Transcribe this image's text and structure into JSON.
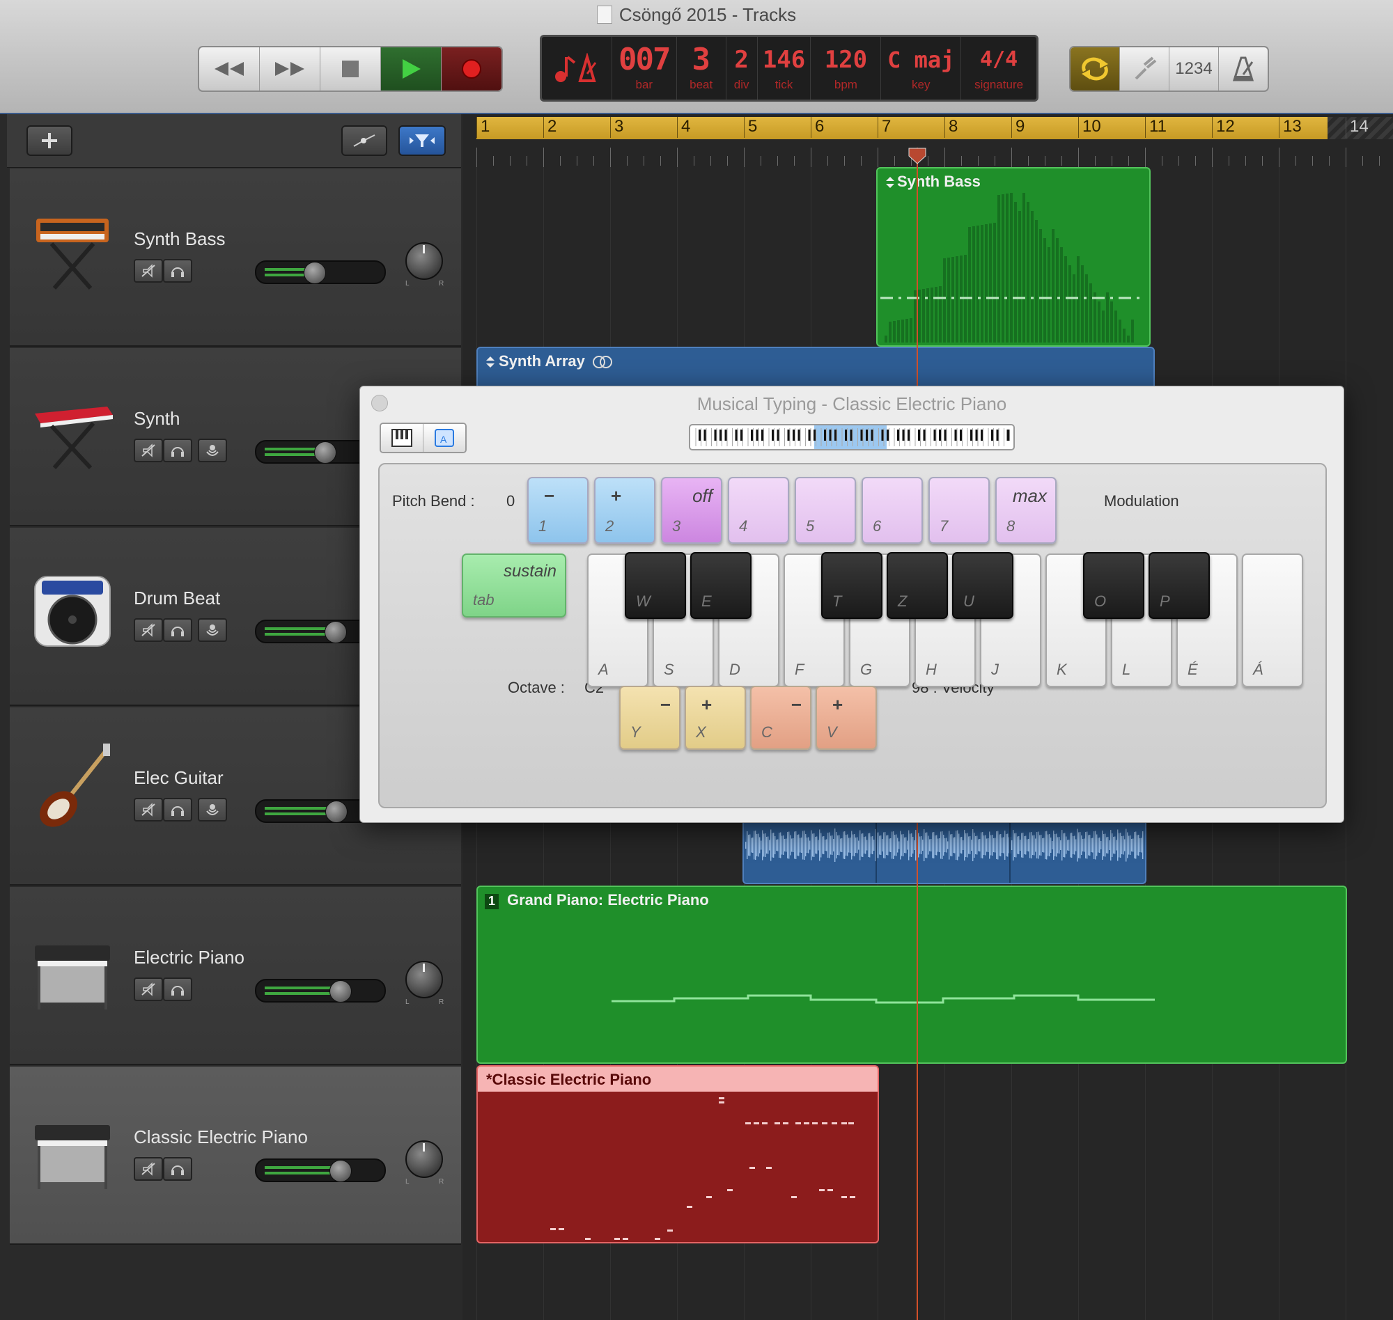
{
  "window": {
    "title": "Csöngő 2015 - Tracks"
  },
  "transport": {
    "buttons": [
      "rewind",
      "fast-forward",
      "stop",
      "play",
      "record"
    ]
  },
  "lcd": {
    "bar": "007",
    "bar_label": "bar",
    "beat": "3",
    "beat_label": "beat",
    "div": "2",
    "div_label": "div",
    "tick": "146",
    "tick_label": "tick",
    "bpm": "120",
    "bpm_label": "bpm",
    "key": "C maj",
    "key_label": "key",
    "signature": "4/4",
    "signature_label": "signature"
  },
  "tools": {
    "count_in": "1234"
  },
  "ruler": {
    "bars": [
      "1",
      "2",
      "3",
      "4",
      "5",
      "6",
      "7",
      "8",
      "9",
      "10",
      "11",
      "12",
      "13",
      "14"
    ]
  },
  "tracks": [
    {
      "name": "Synth Bass",
      "volume": 0.45
    },
    {
      "name": "Synth",
      "volume": 0.55
    },
    {
      "name": "Drum Beat",
      "volume": 0.65
    },
    {
      "name": "Elec Guitar",
      "volume": 0.66
    },
    {
      "name": "Electric Piano",
      "volume": 0.7
    },
    {
      "name": "Classic Electric Piano",
      "volume": 0.7
    }
  ],
  "regions": {
    "synth_bass": "Synth Bass",
    "synth_array": "Synth Array",
    "grand_piano": "Grand Piano: Electric Piano",
    "grand_piano_num": "1",
    "classic_ep": "*Classic Electric Piano"
  },
  "musical_typing": {
    "title": "Musical Typing - Classic Electric Piano",
    "pitch_bend_label": "Pitch Bend :",
    "pitch_bend_value": "0",
    "modulation_label": "Modulation",
    "sustain_label": "sustain",
    "sustain_key": "tab",
    "octave_label": "Octave :",
    "octave_value": "C2",
    "velocity_label": "98 : Velocity",
    "number_keys": [
      {
        "top": "−",
        "key": "1"
      },
      {
        "top": "+",
        "key": "2"
      },
      {
        "top": "off",
        "key": "3"
      },
      {
        "top": "",
        "key": "4"
      },
      {
        "top": "",
        "key": "5"
      },
      {
        "top": "",
        "key": "6"
      },
      {
        "top": "",
        "key": "7"
      },
      {
        "top": "max",
        "key": "8"
      }
    ],
    "white_keys": [
      "A",
      "S",
      "D",
      "F",
      "G",
      "H",
      "J",
      "K",
      "L",
      "É",
      "Á"
    ],
    "black_keys": [
      "W",
      "E",
      "T",
      "Z",
      "U",
      "O",
      "P"
    ],
    "octave_keys": [
      {
        "top": "−",
        "key": "Y"
      },
      {
        "top": "+",
        "key": "X"
      }
    ],
    "velocity_keys": [
      {
        "top": "−",
        "key": "C"
      },
      {
        "top": "+",
        "key": "V"
      }
    ]
  },
  "colors": {
    "green_region": "#1f8f2a",
    "blue_region": "#2e5d94",
    "red_region": "#8c1c1c",
    "playhead": "#d2502a"
  }
}
